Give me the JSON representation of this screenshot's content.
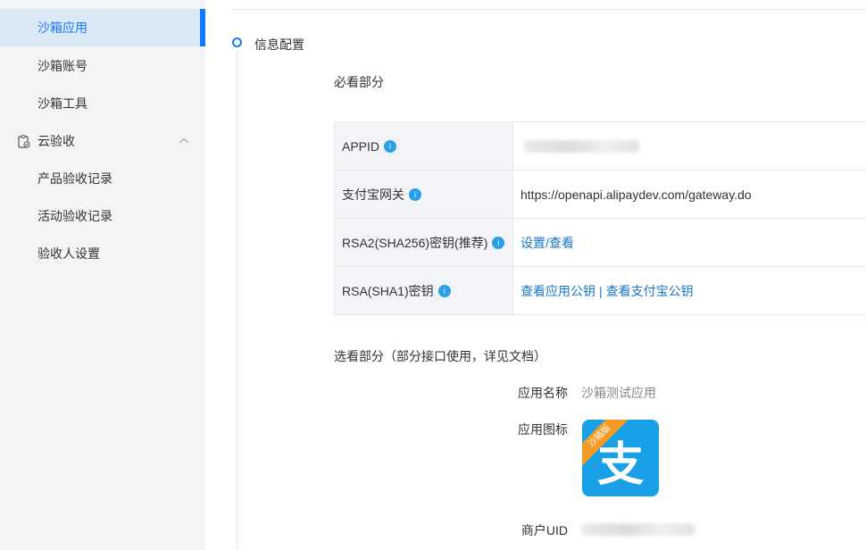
{
  "sidebar": {
    "items": [
      {
        "label": "沙箱应用",
        "active": true
      },
      {
        "label": "沙箱账号"
      },
      {
        "label": "沙箱工具"
      }
    ],
    "group": {
      "label": "云验收",
      "icon": "clipboard-check-icon",
      "chevron": "chevron-up-icon"
    },
    "group_items": [
      {
        "label": "产品验收记录"
      },
      {
        "label": "活动验收记录"
      },
      {
        "label": "验收人设置"
      }
    ]
  },
  "main": {
    "section_title": "信息配置",
    "required_title": "必看部分",
    "config_rows": [
      {
        "key": "APPID",
        "info": "i",
        "value": ""
      },
      {
        "key": "支付宝网关",
        "info": "i",
        "value": "https://openapi.alipaydev.com/gateway.do"
      },
      {
        "key": "RSA2(SHA256)密钥(推荐)",
        "info": "i",
        "link": "设置/查看"
      },
      {
        "key": "RSA(SHA1)密钥",
        "info": "i",
        "link1": "查看应用公钥",
        "separator": "|",
        "link2": "查看支付宝公钥"
      }
    ],
    "optional_title": "选看部分（部分接口使用，详见文档）",
    "app_name_label": "应用名称",
    "app_name_value": "沙箱测试应用",
    "app_icon_label": "应用图标",
    "app_icon_ribbon": "沙箱版",
    "app_icon_glyph": "支",
    "merchant_uid_label": "商户UID"
  },
  "colors": {
    "accent": "#1677ff",
    "link": "#1677c8",
    "info_badge": "#2aa0e8",
    "app_icon_bg": "#1aa0e6",
    "ribbon": "#f59a23"
  }
}
